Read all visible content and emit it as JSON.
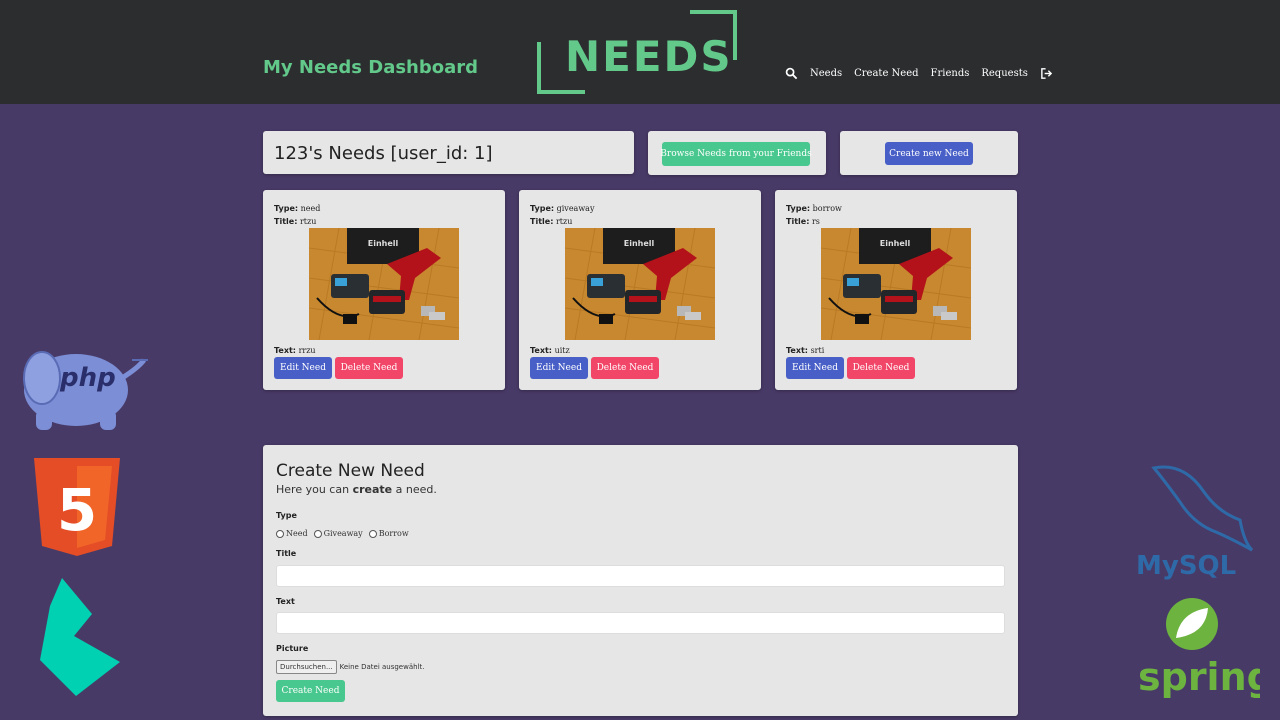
{
  "header": {
    "brand": "My Needs Dashboard",
    "logo_text": "NEEDS",
    "nav": [
      "Needs",
      "Create Need",
      "Friends",
      "Requests"
    ],
    "search_icon": "search-icon",
    "logout_icon": "logout-icon",
    "brand_color": "#62c98a"
  },
  "page": {
    "heading": "123's Needs [user_id: 1]",
    "browse_button": "Browse Needs from your Friends",
    "create_button": "Create new Need"
  },
  "cards": [
    {
      "type_label": "Type:",
      "type": "need",
      "title_label": "Title:",
      "title": "rtzu",
      "text_label": "Text:",
      "text": "rrzu",
      "edit": "Edit Need",
      "delete": "Delete Need"
    },
    {
      "type_label": "Type:",
      "type": "giveaway",
      "title_label": "Title:",
      "title": "rtzu",
      "text_label": "Text:",
      "text": "uitz",
      "edit": "Edit Need",
      "delete": "Delete Need"
    },
    {
      "type_label": "Type:",
      "type": "borrow",
      "title_label": "Title:",
      "title": "rs",
      "text_label": "Text:",
      "text": "srti",
      "edit": "Edit Need",
      "delete": "Delete Need"
    }
  ],
  "form": {
    "title": "Create New Need",
    "subtitle_pre": "Here you can ",
    "subtitle_bold": "create",
    "subtitle_post": " a need.",
    "type_label": "Type",
    "type_options": [
      "Need",
      "Giveaway",
      "Borrow"
    ],
    "title_label": "Title",
    "text_label": "Text",
    "picture_label": "Picture",
    "file_button": "Durchsuchen...",
    "file_status": "Keine Datei ausgewählt.",
    "submit": "Create Need"
  },
  "colors": {
    "background": "#483a67",
    "navbar": "#2b2d2f",
    "green": "#48c78e",
    "blue": "#485fc7",
    "red": "#f14668"
  },
  "decorations": {
    "php_wordmark": "php",
    "mysql_wordmark": "MySQL",
    "spring_wordmark": "spring",
    "html5_mark": "5",
    "photo_brand": "Einhell"
  }
}
